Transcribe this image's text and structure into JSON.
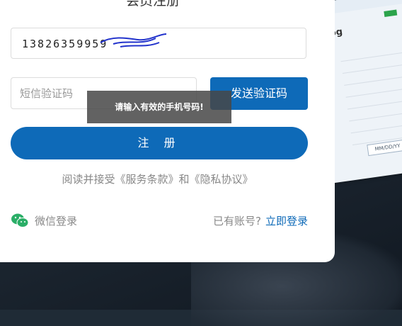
{
  "page": {
    "title": "会员注册",
    "phone_input_value": "13826359959",
    "code_input_placeholder": "短信验证码",
    "send_code_label": "发送验证码",
    "toast_message": "请输入有效的手机号码!",
    "register_label": "注 册",
    "terms_text": "阅读并接受《服务条款》和《隐私协议》",
    "wechat_login_label": "微信登录",
    "have_account_text": "已有账号?",
    "login_link_label": "立即登录"
  },
  "colors": {
    "primary": "#0e6ab8",
    "wechat_green": "#2aae67",
    "toast_bg": "#464646"
  }
}
